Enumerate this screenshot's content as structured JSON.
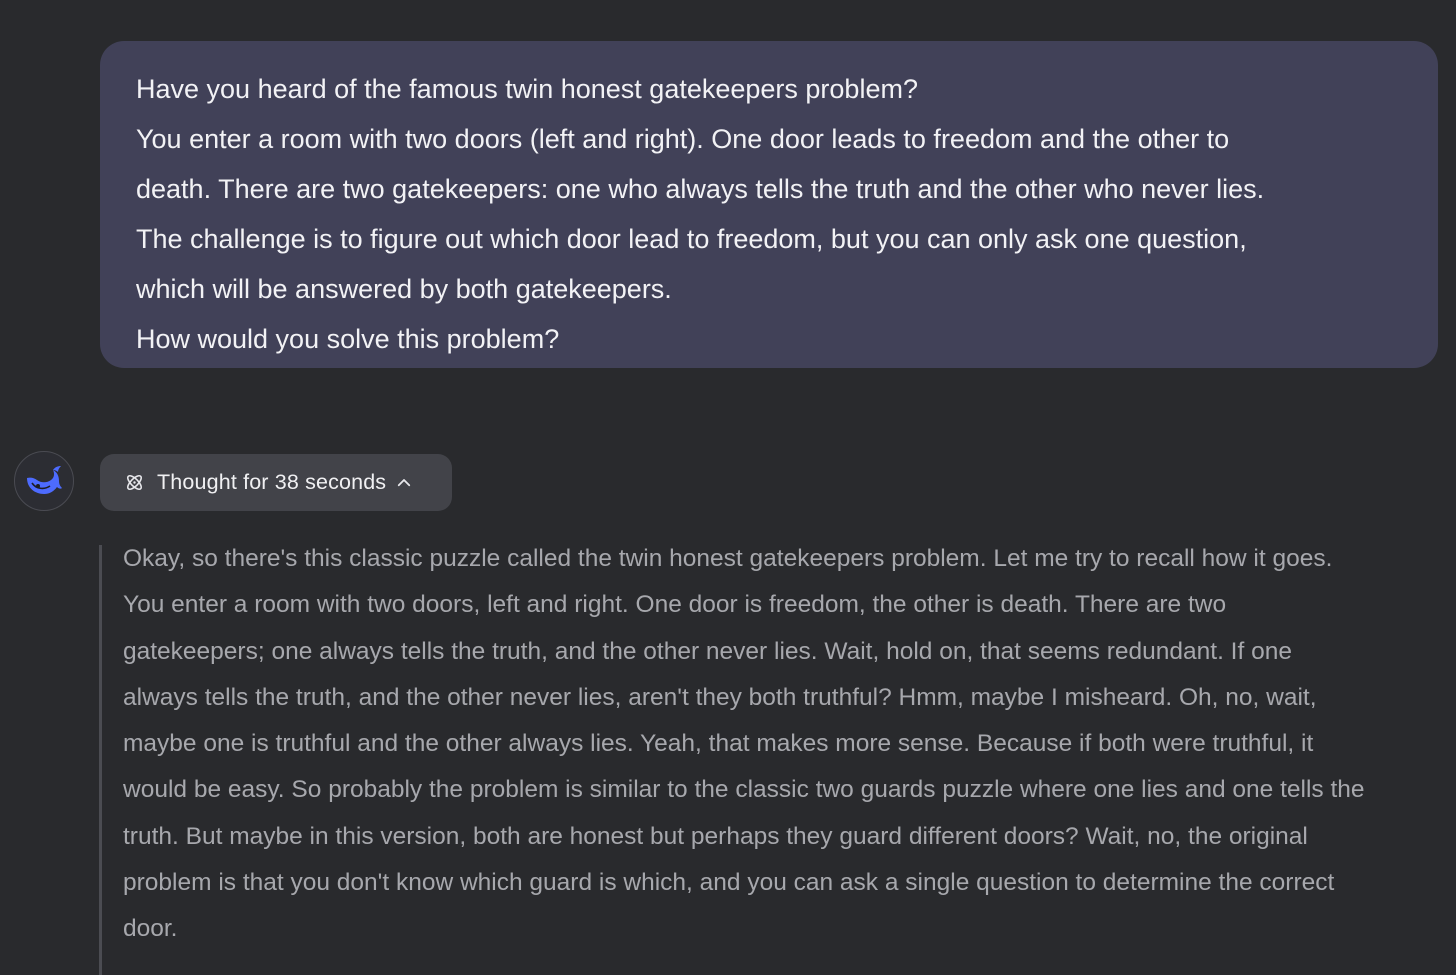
{
  "user_message": {
    "lines": [
      "Have you heard of the famous twin honest gatekeepers problem?",
      "You enter a room with two doors (left and right). One door leads to freedom and the other to",
      "death. There are two gatekeepers: one who always tells the truth and the other who never lies.",
      "The challenge is to figure out which door lead to freedom, but you can only ask one question,",
      "which will be answered by both gatekeepers.",
      "How would you solve this problem?"
    ]
  },
  "assistant": {
    "avatar_icon": "deepseek-whale-icon",
    "thought_toggle": {
      "icon": "atom-icon",
      "label": "Thought for 38 seconds",
      "chevron": "chevron-up-icon"
    },
    "thinking_lines": [
      "Okay, so there's this classic puzzle called the twin honest gatekeepers problem. Let me try to recall how it goes.",
      "You enter a room with two doors, left and right. One door is freedom, the other is death. There are two",
      "gatekeepers; one always tells the truth, and the other never lies. Wait, hold on, that seems redundant. If one",
      "always tells the truth, and the other never lies, aren't they both truthful? Hmm, maybe I misheard. Oh, no, wait,",
      "maybe one is truthful and the other always lies. Yeah, that makes more sense. Because if both were truthful, it",
      "would be easy. So probably the problem is similar to the classic two guards puzzle where one lies and one tells the",
      "truth. But maybe in this version, both are honest but perhaps they guard different doors? Wait, no, the original",
      "problem is that you don't know which guard is which, and you can ask a single question to determine the correct",
      "door."
    ]
  },
  "colors": {
    "background": "#292a2d",
    "user_bubble": "#414158",
    "thought_pill": "#424349",
    "accent_blue": "#4d6bfe"
  }
}
